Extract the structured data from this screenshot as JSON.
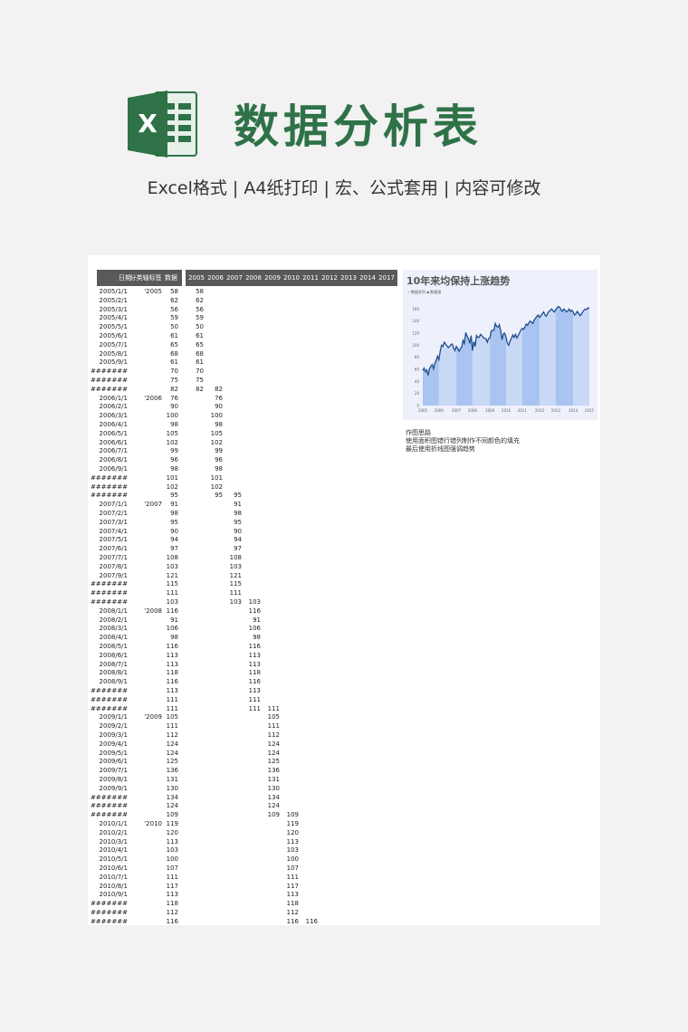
{
  "header": {
    "logo_letter": "X",
    "title": "数据分析表",
    "subtitle": "Excel格式 |  A4纸打印 | 宏、公式套用 | 内容可修改"
  },
  "sheet": {
    "headers": {
      "date": "日期",
      "category": "分类轴标签",
      "data": "数据"
    },
    "year_headers": [
      "2005",
      "2006",
      "2007",
      "2008",
      "2009",
      "2010",
      "2011",
      "2012",
      "2013",
      "2014",
      "2017"
    ],
    "rows": [
      {
        "date": "2005/1/1",
        "cat": "'2005",
        "val": "58",
        "series": [
          58,
          null,
          null,
          null,
          null,
          null,
          null
        ]
      },
      {
        "date": "2005/2/1",
        "cat": "",
        "val": "62",
        "series": [
          62,
          null,
          null,
          null,
          null,
          null,
          null
        ]
      },
      {
        "date": "2005/3/1",
        "cat": "",
        "val": "56",
        "series": [
          56,
          null,
          null,
          null,
          null,
          null,
          null
        ]
      },
      {
        "date": "2005/4/1",
        "cat": "",
        "val": "59",
        "series": [
          59,
          null,
          null,
          null,
          null,
          null,
          null
        ]
      },
      {
        "date": "2005/5/1",
        "cat": "",
        "val": "50",
        "series": [
          50,
          null,
          null,
          null,
          null,
          null,
          null
        ]
      },
      {
        "date": "2005/6/1",
        "cat": "",
        "val": "61",
        "series": [
          61,
          null,
          null,
          null,
          null,
          null,
          null
        ]
      },
      {
        "date": "2005/7/1",
        "cat": "",
        "val": "65",
        "series": [
          65,
          null,
          null,
          null,
          null,
          null,
          null
        ]
      },
      {
        "date": "2005/8/1",
        "cat": "",
        "val": "68",
        "series": [
          68,
          null,
          null,
          null,
          null,
          null,
          null
        ]
      },
      {
        "date": "2005/9/1",
        "cat": "",
        "val": "61",
        "series": [
          61,
          null,
          null,
          null,
          null,
          null,
          null
        ]
      },
      {
        "date": "#######",
        "cat": "",
        "val": "70",
        "series": [
          70,
          null,
          null,
          null,
          null,
          null,
          null
        ]
      },
      {
        "date": "#######",
        "cat": "",
        "val": "75",
        "series": [
          75,
          null,
          null,
          null,
          null,
          null,
          null
        ]
      },
      {
        "date": "#######",
        "cat": "",
        "val": "82",
        "series": [
          82,
          82,
          null,
          null,
          null,
          null,
          null
        ]
      },
      {
        "date": "2006/1/1",
        "cat": "'2006",
        "val": "76",
        "series": [
          null,
          76,
          null,
          null,
          null,
          null,
          null
        ]
      },
      {
        "date": "2006/2/1",
        "cat": "",
        "val": "90",
        "series": [
          null,
          90,
          null,
          null,
          null,
          null,
          null
        ]
      },
      {
        "date": "2006/3/1",
        "cat": "",
        "val": "100",
        "series": [
          null,
          100,
          null,
          null,
          null,
          null,
          null
        ]
      },
      {
        "date": "2006/4/1",
        "cat": "",
        "val": "98",
        "series": [
          null,
          98,
          null,
          null,
          null,
          null,
          null
        ]
      },
      {
        "date": "2006/5/1",
        "cat": "",
        "val": "105",
        "series": [
          null,
          105,
          null,
          null,
          null,
          null,
          null
        ]
      },
      {
        "date": "2006/6/1",
        "cat": "",
        "val": "102",
        "series": [
          null,
          102,
          null,
          null,
          null,
          null,
          null
        ]
      },
      {
        "date": "2006/7/1",
        "cat": "",
        "val": "99",
        "series": [
          null,
          99,
          null,
          null,
          null,
          null,
          null
        ]
      },
      {
        "date": "2006/8/1",
        "cat": "",
        "val": "96",
        "series": [
          null,
          96,
          null,
          null,
          null,
          null,
          null
        ]
      },
      {
        "date": "2006/9/1",
        "cat": "",
        "val": "98",
        "series": [
          null,
          98,
          null,
          null,
          null,
          null,
          null
        ]
      },
      {
        "date": "#######",
        "cat": "",
        "val": "101",
        "series": [
          null,
          101,
          null,
          null,
          null,
          null,
          null
        ]
      },
      {
        "date": "#######",
        "cat": "",
        "val": "102",
        "series": [
          null,
          102,
          null,
          null,
          null,
          null,
          null
        ]
      },
      {
        "date": "#######",
        "cat": "",
        "val": "95",
        "series": [
          null,
          95,
          95,
          null,
          null,
          null,
          null
        ]
      },
      {
        "date": "2007/1/1",
        "cat": "'2007",
        "val": "91",
        "series": [
          null,
          null,
          91,
          null,
          null,
          null,
          null
        ]
      },
      {
        "date": "2007/2/1",
        "cat": "",
        "val": "98",
        "series": [
          null,
          null,
          98,
          null,
          null,
          null,
          null
        ]
      },
      {
        "date": "2007/3/1",
        "cat": "",
        "val": "95",
        "series": [
          null,
          null,
          95,
          null,
          null,
          null,
          null
        ]
      },
      {
        "date": "2007/4/1",
        "cat": "",
        "val": "90",
        "series": [
          null,
          null,
          90,
          null,
          null,
          null,
          null
        ]
      },
      {
        "date": "2007/5/1",
        "cat": "",
        "val": "94",
        "series": [
          null,
          null,
          94,
          null,
          null,
          null,
          null
        ]
      },
      {
        "date": "2007/6/1",
        "cat": "",
        "val": "97",
        "series": [
          null,
          null,
          97,
          null,
          null,
          null,
          null
        ]
      },
      {
        "date": "2007/7/1",
        "cat": "",
        "val": "108",
        "series": [
          null,
          null,
          108,
          null,
          null,
          null,
          null
        ]
      },
      {
        "date": "2007/8/1",
        "cat": "",
        "val": "103",
        "series": [
          null,
          null,
          103,
          null,
          null,
          null,
          null
        ]
      },
      {
        "date": "2007/9/1",
        "cat": "",
        "val": "121",
        "series": [
          null,
          null,
          121,
          null,
          null,
          null,
          null
        ]
      },
      {
        "date": "#######",
        "cat": "",
        "val": "115",
        "series": [
          null,
          null,
          115,
          null,
          null,
          null,
          null
        ]
      },
      {
        "date": "#######",
        "cat": "",
        "val": "111",
        "series": [
          null,
          null,
          111,
          null,
          null,
          null,
          null
        ]
      },
      {
        "date": "#######",
        "cat": "",
        "val": "103",
        "series": [
          null,
          null,
          103,
          103,
          null,
          null,
          null
        ]
      },
      {
        "date": "2008/1/1",
        "cat": "'2008",
        "val": "116",
        "series": [
          null,
          null,
          null,
          116,
          null,
          null,
          null
        ]
      },
      {
        "date": "2008/2/1",
        "cat": "",
        "val": "91",
        "series": [
          null,
          null,
          null,
          91,
          null,
          null,
          null
        ]
      },
      {
        "date": "2008/3/1",
        "cat": "",
        "val": "106",
        "series": [
          null,
          null,
          null,
          106,
          null,
          null,
          null
        ]
      },
      {
        "date": "2008/4/1",
        "cat": "",
        "val": "98",
        "series": [
          null,
          null,
          null,
          98,
          null,
          null,
          null
        ]
      },
      {
        "date": "2008/5/1",
        "cat": "",
        "val": "116",
        "series": [
          null,
          null,
          null,
          116,
          null,
          null,
          null
        ]
      },
      {
        "date": "2008/6/1",
        "cat": "",
        "val": "113",
        "series": [
          null,
          null,
          null,
          113,
          null,
          null,
          null
        ]
      },
      {
        "date": "2008/7/1",
        "cat": "",
        "val": "113",
        "series": [
          null,
          null,
          null,
          113,
          null,
          null,
          null
        ]
      },
      {
        "date": "2008/8/1",
        "cat": "",
        "val": "118",
        "series": [
          null,
          null,
          null,
          118,
          null,
          null,
          null
        ]
      },
      {
        "date": "2008/9/1",
        "cat": "",
        "val": "116",
        "series": [
          null,
          null,
          null,
          116,
          null,
          null,
          null
        ]
      },
      {
        "date": "#######",
        "cat": "",
        "val": "113",
        "series": [
          null,
          null,
          null,
          113,
          null,
          null,
          null
        ]
      },
      {
        "date": "#######",
        "cat": "",
        "val": "111",
        "series": [
          null,
          null,
          null,
          111,
          null,
          null,
          null
        ]
      },
      {
        "date": "#######",
        "cat": "",
        "val": "111",
        "series": [
          null,
          null,
          null,
          111,
          111,
          null,
          null
        ]
      },
      {
        "date": "2009/1/1",
        "cat": "'2009",
        "val": "105",
        "series": [
          null,
          null,
          null,
          null,
          105,
          null,
          null
        ]
      },
      {
        "date": "2009/2/1",
        "cat": "",
        "val": "111",
        "series": [
          null,
          null,
          null,
          null,
          111,
          null,
          null
        ]
      },
      {
        "date": "2009/3/1",
        "cat": "",
        "val": "112",
        "series": [
          null,
          null,
          null,
          null,
          112,
          null,
          null
        ]
      },
      {
        "date": "2009/4/1",
        "cat": "",
        "val": "124",
        "series": [
          null,
          null,
          null,
          null,
          124,
          null,
          null
        ]
      },
      {
        "date": "2009/5/1",
        "cat": "",
        "val": "124",
        "series": [
          null,
          null,
          null,
          null,
          124,
          null,
          null
        ]
      },
      {
        "date": "2009/6/1",
        "cat": "",
        "val": "125",
        "series": [
          null,
          null,
          null,
          null,
          125,
          null,
          null
        ]
      },
      {
        "date": "2009/7/1",
        "cat": "",
        "val": "136",
        "series": [
          null,
          null,
          null,
          null,
          136,
          null,
          null
        ]
      },
      {
        "date": "2009/8/1",
        "cat": "",
        "val": "131",
        "series": [
          null,
          null,
          null,
          null,
          131,
          null,
          null
        ]
      },
      {
        "date": "2009/9/1",
        "cat": "",
        "val": "130",
        "series": [
          null,
          null,
          null,
          null,
          130,
          null,
          null
        ]
      },
      {
        "date": "#######",
        "cat": "",
        "val": "134",
        "series": [
          null,
          null,
          null,
          null,
          134,
          null,
          null
        ]
      },
      {
        "date": "#######",
        "cat": "",
        "val": "124",
        "series": [
          null,
          null,
          null,
          null,
          124,
          null,
          null
        ]
      },
      {
        "date": "#######",
        "cat": "",
        "val": "109",
        "series": [
          null,
          null,
          null,
          null,
          109,
          109,
          null
        ]
      },
      {
        "date": "2010/1/1",
        "cat": "'2010",
        "val": "119",
        "series": [
          null,
          null,
          null,
          null,
          null,
          119,
          null
        ]
      },
      {
        "date": "2010/2/1",
        "cat": "",
        "val": "120",
        "series": [
          null,
          null,
          null,
          null,
          null,
          120,
          null
        ]
      },
      {
        "date": "2010/3/1",
        "cat": "",
        "val": "113",
        "series": [
          null,
          null,
          null,
          null,
          null,
          113,
          null
        ]
      },
      {
        "date": "2010/4/1",
        "cat": "",
        "val": "103",
        "series": [
          null,
          null,
          null,
          null,
          null,
          103,
          null
        ]
      },
      {
        "date": "2010/5/1",
        "cat": "",
        "val": "100",
        "series": [
          null,
          null,
          null,
          null,
          null,
          100,
          null
        ]
      },
      {
        "date": "2010/6/1",
        "cat": "",
        "val": "107",
        "series": [
          null,
          null,
          null,
          null,
          null,
          107,
          null
        ]
      },
      {
        "date": "2010/7/1",
        "cat": "",
        "val": "111",
        "series": [
          null,
          null,
          null,
          null,
          null,
          111,
          null
        ]
      },
      {
        "date": "2010/8/1",
        "cat": "",
        "val": "117",
        "series": [
          null,
          null,
          null,
          null,
          null,
          117,
          null
        ]
      },
      {
        "date": "2010/9/1",
        "cat": "",
        "val": "113",
        "series": [
          null,
          null,
          null,
          null,
          null,
          113,
          null
        ]
      },
      {
        "date": "#######",
        "cat": "",
        "val": "118",
        "series": [
          null,
          null,
          null,
          null,
          null,
          118,
          null
        ]
      },
      {
        "date": "#######",
        "cat": "",
        "val": "112",
        "series": [
          null,
          null,
          null,
          null,
          null,
          112,
          null
        ]
      },
      {
        "date": "#######",
        "cat": "",
        "val": "116",
        "series": [
          null,
          null,
          null,
          null,
          null,
          116,
          116
        ]
      }
    ]
  },
  "chart": {
    "title": "10年来均保持上涨趋势",
    "subtitle": "—数据系列 ▪ 数据源",
    "line_color": "#1f4e8c",
    "band_colors": [
      "#a9c4f0",
      "#c9d8f5"
    ],
    "notes": [
      "作图思路",
      "使用面积图错行错列制作不同颜色的填充",
      "最后使用折线图强调趋势"
    ]
  },
  "chart_data": {
    "type": "area",
    "title": "10年来均保持上涨趋势",
    "x": [
      "2005",
      "2006",
      "2007",
      "2008",
      "2009",
      "2010",
      "2011",
      "2012",
      "2013",
      "2014",
      "2015"
    ],
    "ylim": [
      0,
      180
    ],
    "yticks": [
      0,
      20,
      40,
      60,
      80,
      100,
      120,
      140,
      160
    ],
    "series": [
      {
        "values": [
          58,
          62,
          56,
          59,
          50,
          61,
          65,
          68,
          61,
          70,
          75,
          82,
          76,
          90,
          100,
          98,
          105,
          102,
          99,
          96,
          98,
          101,
          102,
          95,
          91,
          98,
          95,
          90,
          94,
          97,
          108,
          103,
          121,
          115,
          111,
          103,
          116,
          91,
          106,
          98,
          116,
          113,
          113,
          118,
          116,
          113,
          111,
          111,
          105,
          111,
          112,
          124,
          124,
          125,
          136,
          131,
          130,
          134,
          124,
          109,
          119,
          120,
          113,
          103,
          100,
          107,
          111,
          117,
          113,
          118,
          112,
          116,
          120,
          125,
          128,
          126,
          130,
          135,
          133,
          137,
          140,
          138,
          136,
          142,
          145,
          148,
          150,
          146,
          149,
          152,
          155,
          150,
          148,
          153,
          156,
          158,
          160,
          157,
          155,
          159,
          162,
          164,
          163,
          158,
          156,
          160,
          158,
          155,
          157,
          160,
          156,
          158,
          155,
          150,
          152,
          156,
          153,
          149,
          151,
          155,
          158,
          160,
          159,
          162,
          161
        ]
      }
    ]
  }
}
